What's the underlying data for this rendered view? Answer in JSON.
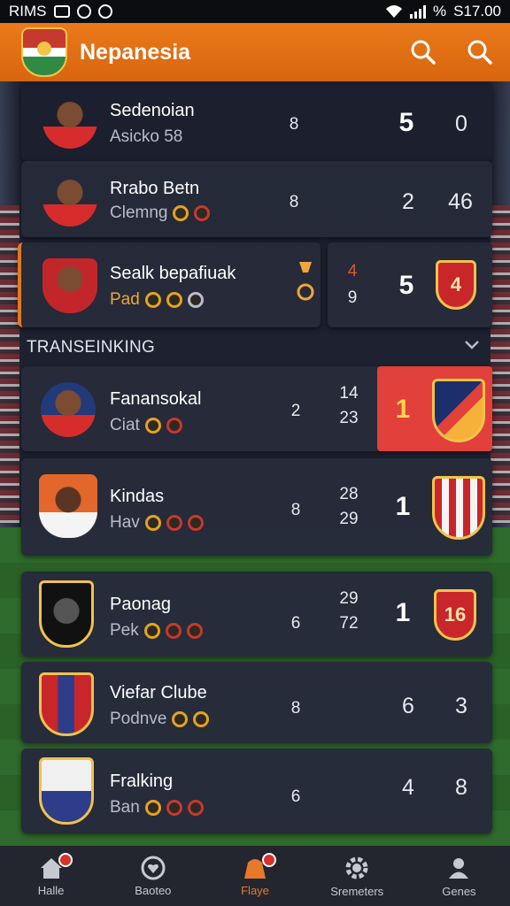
{
  "status_bar": {
    "left": "RIMS",
    "battery": "%",
    "time": "S17.00"
  },
  "header": {
    "title": "Nepanesia"
  },
  "rows_top": [
    {
      "name": "Sedenoian",
      "sub": "Asicko 58",
      "mid": "8",
      "score": "5",
      "right": "0"
    },
    {
      "name": "Rrabo Betn",
      "sub": "Clemng",
      "mid": "8",
      "score": "2",
      "right": "46"
    },
    {
      "name": "Sealk bepafiuak",
      "sub": "Pad",
      "mid_top": "4",
      "mid_bottom": "9",
      "score": "5",
      "badge": "4"
    }
  ],
  "section": {
    "label": "TRANSEINKING"
  },
  "rows_main": [
    {
      "name": "Fanansokal",
      "sub": "Ciat",
      "mid": "2",
      "stat_top": "14",
      "stat_bottom": "23",
      "score": "1"
    },
    {
      "name": "Kindas",
      "sub": "Hav",
      "mid": "8",
      "stat_top": "28",
      "stat_bottom": "29",
      "score": "1"
    },
    {
      "name": "Paonag",
      "sub": "Pek",
      "mid": "6",
      "stat_top": "29",
      "stat_bottom": "72",
      "score": "1",
      "badge": "16"
    },
    {
      "name": "Viefar Clube",
      "sub": "Podnve",
      "mid": "8",
      "score": "6",
      "right": "3"
    },
    {
      "name": "Fralking",
      "sub": "Ban",
      "mid": "6",
      "score": "4",
      "right": "8"
    }
  ],
  "bottom_nav": [
    {
      "label": "Halle",
      "icon": "home-icon"
    },
    {
      "label": "Baoteo",
      "icon": "heart-icon"
    },
    {
      "label": "Flaye",
      "icon": "player-icon"
    },
    {
      "label": "Sremeters",
      "icon": "gear-icon"
    },
    {
      "label": "Genes",
      "icon": "profile-icon"
    }
  ],
  "colors": {
    "header": "#ea7a1a",
    "accent": "#e07a1f",
    "highlight": "#e2403a",
    "card": "#262a3a"
  }
}
